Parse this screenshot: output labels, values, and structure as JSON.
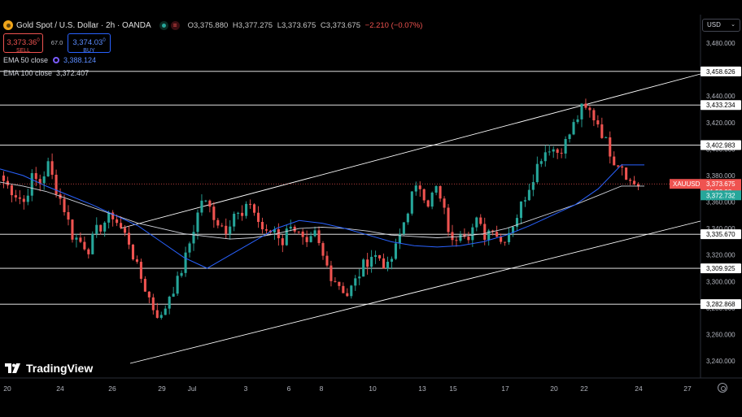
{
  "header": {
    "title": "Gold Spot / U.S. Dollar · 2h · OANDA",
    "open": "O3,375.880",
    "high": "H3,377.275",
    "low": "L3,373.675",
    "close": "C3,373.675",
    "change": "−2.210 (−0.07%)"
  },
  "trade": {
    "sell_price": "3,373.36",
    "sell_sup": "0",
    "sell_label": "SELL",
    "spread": "67.0",
    "buy_price": "3,374.03",
    "buy_sup": "0",
    "buy_label": "BUY"
  },
  "indicators": {
    "ema50_label": "EMA 50 close",
    "ema50_value": "3,388.124",
    "ema100_label": "EMA 100 close",
    "ema100_value": "3,372.407"
  },
  "axis": {
    "currency": "USD"
  },
  "brand": "TradingView",
  "colors": {
    "up": "#26a69a",
    "down": "#ef5350",
    "ema50": "#2962ff",
    "ema100": "#d1d4dc",
    "bg": "#000000",
    "level": "#ffffff"
  },
  "chart_data": {
    "type": "candlestick",
    "symbol": "XAUUSD",
    "ylim": [
      3228,
      3500
    ],
    "y_ticks": [
      3240,
      3260,
      3280,
      3300,
      3320,
      3340,
      3360,
      3380,
      3400,
      3420,
      3440,
      3460,
      3480
    ],
    "y_tick_labels": [
      "3,240.000",
      "3,260.000",
      "3,280.000",
      "3,300.000",
      "3,320.000",
      "3,340.000",
      "3,360.000",
      "3,380.000",
      "3,400.000",
      "3,420.000",
      "3,440.000",
      "3,460.000",
      "3,480.000"
    ],
    "x_labels": [
      "20",
      "24",
      "26",
      "29",
      "Jul",
      "3",
      "6",
      "8",
      "10",
      "13",
      "15",
      "17",
      "20",
      "22",
      "24",
      "27"
    ],
    "levels": [
      {
        "value": 3458.626,
        "label": "3,458.626"
      },
      {
        "value": 3433.234,
        "label": "3,433.234"
      },
      {
        "value": 3402.983,
        "label": "3,402.983"
      },
      {
        "value": 3335.67,
        "label": "3,335.670"
      },
      {
        "value": 3309.925,
        "label": "3,309.925"
      },
      {
        "value": 3282.868,
        "label": "3,282.868"
      }
    ],
    "channel": {
      "upper": [
        [
          3342,
          3457
        ]
      ],
      "lower": [
        [
          3242,
          3345
        ]
      ]
    },
    "current_price": {
      "value": 3373.675,
      "label": "3,373.675",
      "countdown": "01:52:08",
      "symbol_label": "XAUUSD"
    },
    "ema100_marker": {
      "value": 3372.407,
      "label": "3,372.732"
    },
    "price_path": [
      3380,
      3372,
      3366,
      3360,
      3378,
      3375,
      3388,
      3370,
      3355,
      3335,
      3330,
      3325,
      3338,
      3345,
      3350,
      3340,
      3330,
      3310,
      3295,
      3280,
      3272,
      3290,
      3300,
      3318,
      3340,
      3362,
      3355,
      3345,
      3340,
      3352,
      3348,
      3360,
      3345,
      3335,
      3340,
      3330,
      3345,
      3335,
      3325,
      3335,
      3318,
      3305,
      3298,
      3290,
      3300,
      3312,
      3320,
      3318,
      3310,
      3325,
      3345,
      3365,
      3372,
      3360,
      3370,
      3352,
      3328,
      3340,
      3336,
      3345,
      3335,
      3342,
      3330,
      3338,
      3350,
      3365,
      3380,
      3395,
      3402,
      3398,
      3405,
      3418,
      3430,
      3428,
      3420,
      3405,
      3392,
      3388,
      3375,
      3373
    ],
    "ema50_path": [
      3385,
      3380,
      3372,
      3365,
      3358,
      3350,
      3342,
      3330,
      3318,
      3310,
      3320,
      3330,
      3340,
      3346,
      3344,
      3340,
      3335,
      3330,
      3327,
      3326,
      3327,
      3330,
      3335,
      3342,
      3350,
      3358,
      3370,
      3388,
      3388
    ],
    "ema100_path": [
      3375,
      3372,
      3368,
      3362,
      3356,
      3350,
      3344,
      3340,
      3336,
      3334,
      3332,
      3333,
      3336,
      3340,
      3341,
      3340,
      3338,
      3335,
      3334,
      3333,
      3334,
      3336,
      3340,
      3346,
      3352,
      3358,
      3365,
      3372,
      3372
    ]
  }
}
